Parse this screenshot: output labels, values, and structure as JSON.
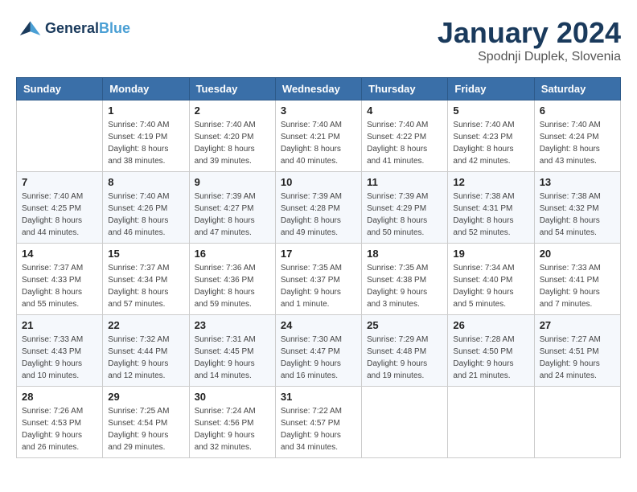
{
  "header": {
    "logo_line1": "General",
    "logo_line2": "Blue",
    "month": "January 2024",
    "location": "Spodnji Duplek, Slovenia"
  },
  "weekdays": [
    "Sunday",
    "Monday",
    "Tuesday",
    "Wednesday",
    "Thursday",
    "Friday",
    "Saturday"
  ],
  "weeks": [
    [
      {
        "day": "",
        "sunrise": "",
        "sunset": "",
        "daylight": ""
      },
      {
        "day": "1",
        "sunrise": "Sunrise: 7:40 AM",
        "sunset": "Sunset: 4:19 PM",
        "daylight": "Daylight: 8 hours and 38 minutes."
      },
      {
        "day": "2",
        "sunrise": "Sunrise: 7:40 AM",
        "sunset": "Sunset: 4:20 PM",
        "daylight": "Daylight: 8 hours and 39 minutes."
      },
      {
        "day": "3",
        "sunrise": "Sunrise: 7:40 AM",
        "sunset": "Sunset: 4:21 PM",
        "daylight": "Daylight: 8 hours and 40 minutes."
      },
      {
        "day": "4",
        "sunrise": "Sunrise: 7:40 AM",
        "sunset": "Sunset: 4:22 PM",
        "daylight": "Daylight: 8 hours and 41 minutes."
      },
      {
        "day": "5",
        "sunrise": "Sunrise: 7:40 AM",
        "sunset": "Sunset: 4:23 PM",
        "daylight": "Daylight: 8 hours and 42 minutes."
      },
      {
        "day": "6",
        "sunrise": "Sunrise: 7:40 AM",
        "sunset": "Sunset: 4:24 PM",
        "daylight": "Daylight: 8 hours and 43 minutes."
      }
    ],
    [
      {
        "day": "7",
        "sunrise": "Sunrise: 7:40 AM",
        "sunset": "Sunset: 4:25 PM",
        "daylight": "Daylight: 8 hours and 44 minutes."
      },
      {
        "day": "8",
        "sunrise": "Sunrise: 7:40 AM",
        "sunset": "Sunset: 4:26 PM",
        "daylight": "Daylight: 8 hours and 46 minutes."
      },
      {
        "day": "9",
        "sunrise": "Sunrise: 7:39 AM",
        "sunset": "Sunset: 4:27 PM",
        "daylight": "Daylight: 8 hours and 47 minutes."
      },
      {
        "day": "10",
        "sunrise": "Sunrise: 7:39 AM",
        "sunset": "Sunset: 4:28 PM",
        "daylight": "Daylight: 8 hours and 49 minutes."
      },
      {
        "day": "11",
        "sunrise": "Sunrise: 7:39 AM",
        "sunset": "Sunset: 4:29 PM",
        "daylight": "Daylight: 8 hours and 50 minutes."
      },
      {
        "day": "12",
        "sunrise": "Sunrise: 7:38 AM",
        "sunset": "Sunset: 4:31 PM",
        "daylight": "Daylight: 8 hours and 52 minutes."
      },
      {
        "day": "13",
        "sunrise": "Sunrise: 7:38 AM",
        "sunset": "Sunset: 4:32 PM",
        "daylight": "Daylight: 8 hours and 54 minutes."
      }
    ],
    [
      {
        "day": "14",
        "sunrise": "Sunrise: 7:37 AM",
        "sunset": "Sunset: 4:33 PM",
        "daylight": "Daylight: 8 hours and 55 minutes."
      },
      {
        "day": "15",
        "sunrise": "Sunrise: 7:37 AM",
        "sunset": "Sunset: 4:34 PM",
        "daylight": "Daylight: 8 hours and 57 minutes."
      },
      {
        "day": "16",
        "sunrise": "Sunrise: 7:36 AM",
        "sunset": "Sunset: 4:36 PM",
        "daylight": "Daylight: 8 hours and 59 minutes."
      },
      {
        "day": "17",
        "sunrise": "Sunrise: 7:35 AM",
        "sunset": "Sunset: 4:37 PM",
        "daylight": "Daylight: 9 hours and 1 minute."
      },
      {
        "day": "18",
        "sunrise": "Sunrise: 7:35 AM",
        "sunset": "Sunset: 4:38 PM",
        "daylight": "Daylight: 9 hours and 3 minutes."
      },
      {
        "day": "19",
        "sunrise": "Sunrise: 7:34 AM",
        "sunset": "Sunset: 4:40 PM",
        "daylight": "Daylight: 9 hours and 5 minutes."
      },
      {
        "day": "20",
        "sunrise": "Sunrise: 7:33 AM",
        "sunset": "Sunset: 4:41 PM",
        "daylight": "Daylight: 9 hours and 7 minutes."
      }
    ],
    [
      {
        "day": "21",
        "sunrise": "Sunrise: 7:33 AM",
        "sunset": "Sunset: 4:43 PM",
        "daylight": "Daylight: 9 hours and 10 minutes."
      },
      {
        "day": "22",
        "sunrise": "Sunrise: 7:32 AM",
        "sunset": "Sunset: 4:44 PM",
        "daylight": "Daylight: 9 hours and 12 minutes."
      },
      {
        "day": "23",
        "sunrise": "Sunrise: 7:31 AM",
        "sunset": "Sunset: 4:45 PM",
        "daylight": "Daylight: 9 hours and 14 minutes."
      },
      {
        "day": "24",
        "sunrise": "Sunrise: 7:30 AM",
        "sunset": "Sunset: 4:47 PM",
        "daylight": "Daylight: 9 hours and 16 minutes."
      },
      {
        "day": "25",
        "sunrise": "Sunrise: 7:29 AM",
        "sunset": "Sunset: 4:48 PM",
        "daylight": "Daylight: 9 hours and 19 minutes."
      },
      {
        "day": "26",
        "sunrise": "Sunrise: 7:28 AM",
        "sunset": "Sunset: 4:50 PM",
        "daylight": "Daylight: 9 hours and 21 minutes."
      },
      {
        "day": "27",
        "sunrise": "Sunrise: 7:27 AM",
        "sunset": "Sunset: 4:51 PM",
        "daylight": "Daylight: 9 hours and 24 minutes."
      }
    ],
    [
      {
        "day": "28",
        "sunrise": "Sunrise: 7:26 AM",
        "sunset": "Sunset: 4:53 PM",
        "daylight": "Daylight: 9 hours and 26 minutes."
      },
      {
        "day": "29",
        "sunrise": "Sunrise: 7:25 AM",
        "sunset": "Sunset: 4:54 PM",
        "daylight": "Daylight: 9 hours and 29 minutes."
      },
      {
        "day": "30",
        "sunrise": "Sunrise: 7:24 AM",
        "sunset": "Sunset: 4:56 PM",
        "daylight": "Daylight: 9 hours and 32 minutes."
      },
      {
        "day": "31",
        "sunrise": "Sunrise: 7:22 AM",
        "sunset": "Sunset: 4:57 PM",
        "daylight": "Daylight: 9 hours and 34 minutes."
      },
      {
        "day": "",
        "sunrise": "",
        "sunset": "",
        "daylight": ""
      },
      {
        "day": "",
        "sunrise": "",
        "sunset": "",
        "daylight": ""
      },
      {
        "day": "",
        "sunrise": "",
        "sunset": "",
        "daylight": ""
      }
    ]
  ]
}
